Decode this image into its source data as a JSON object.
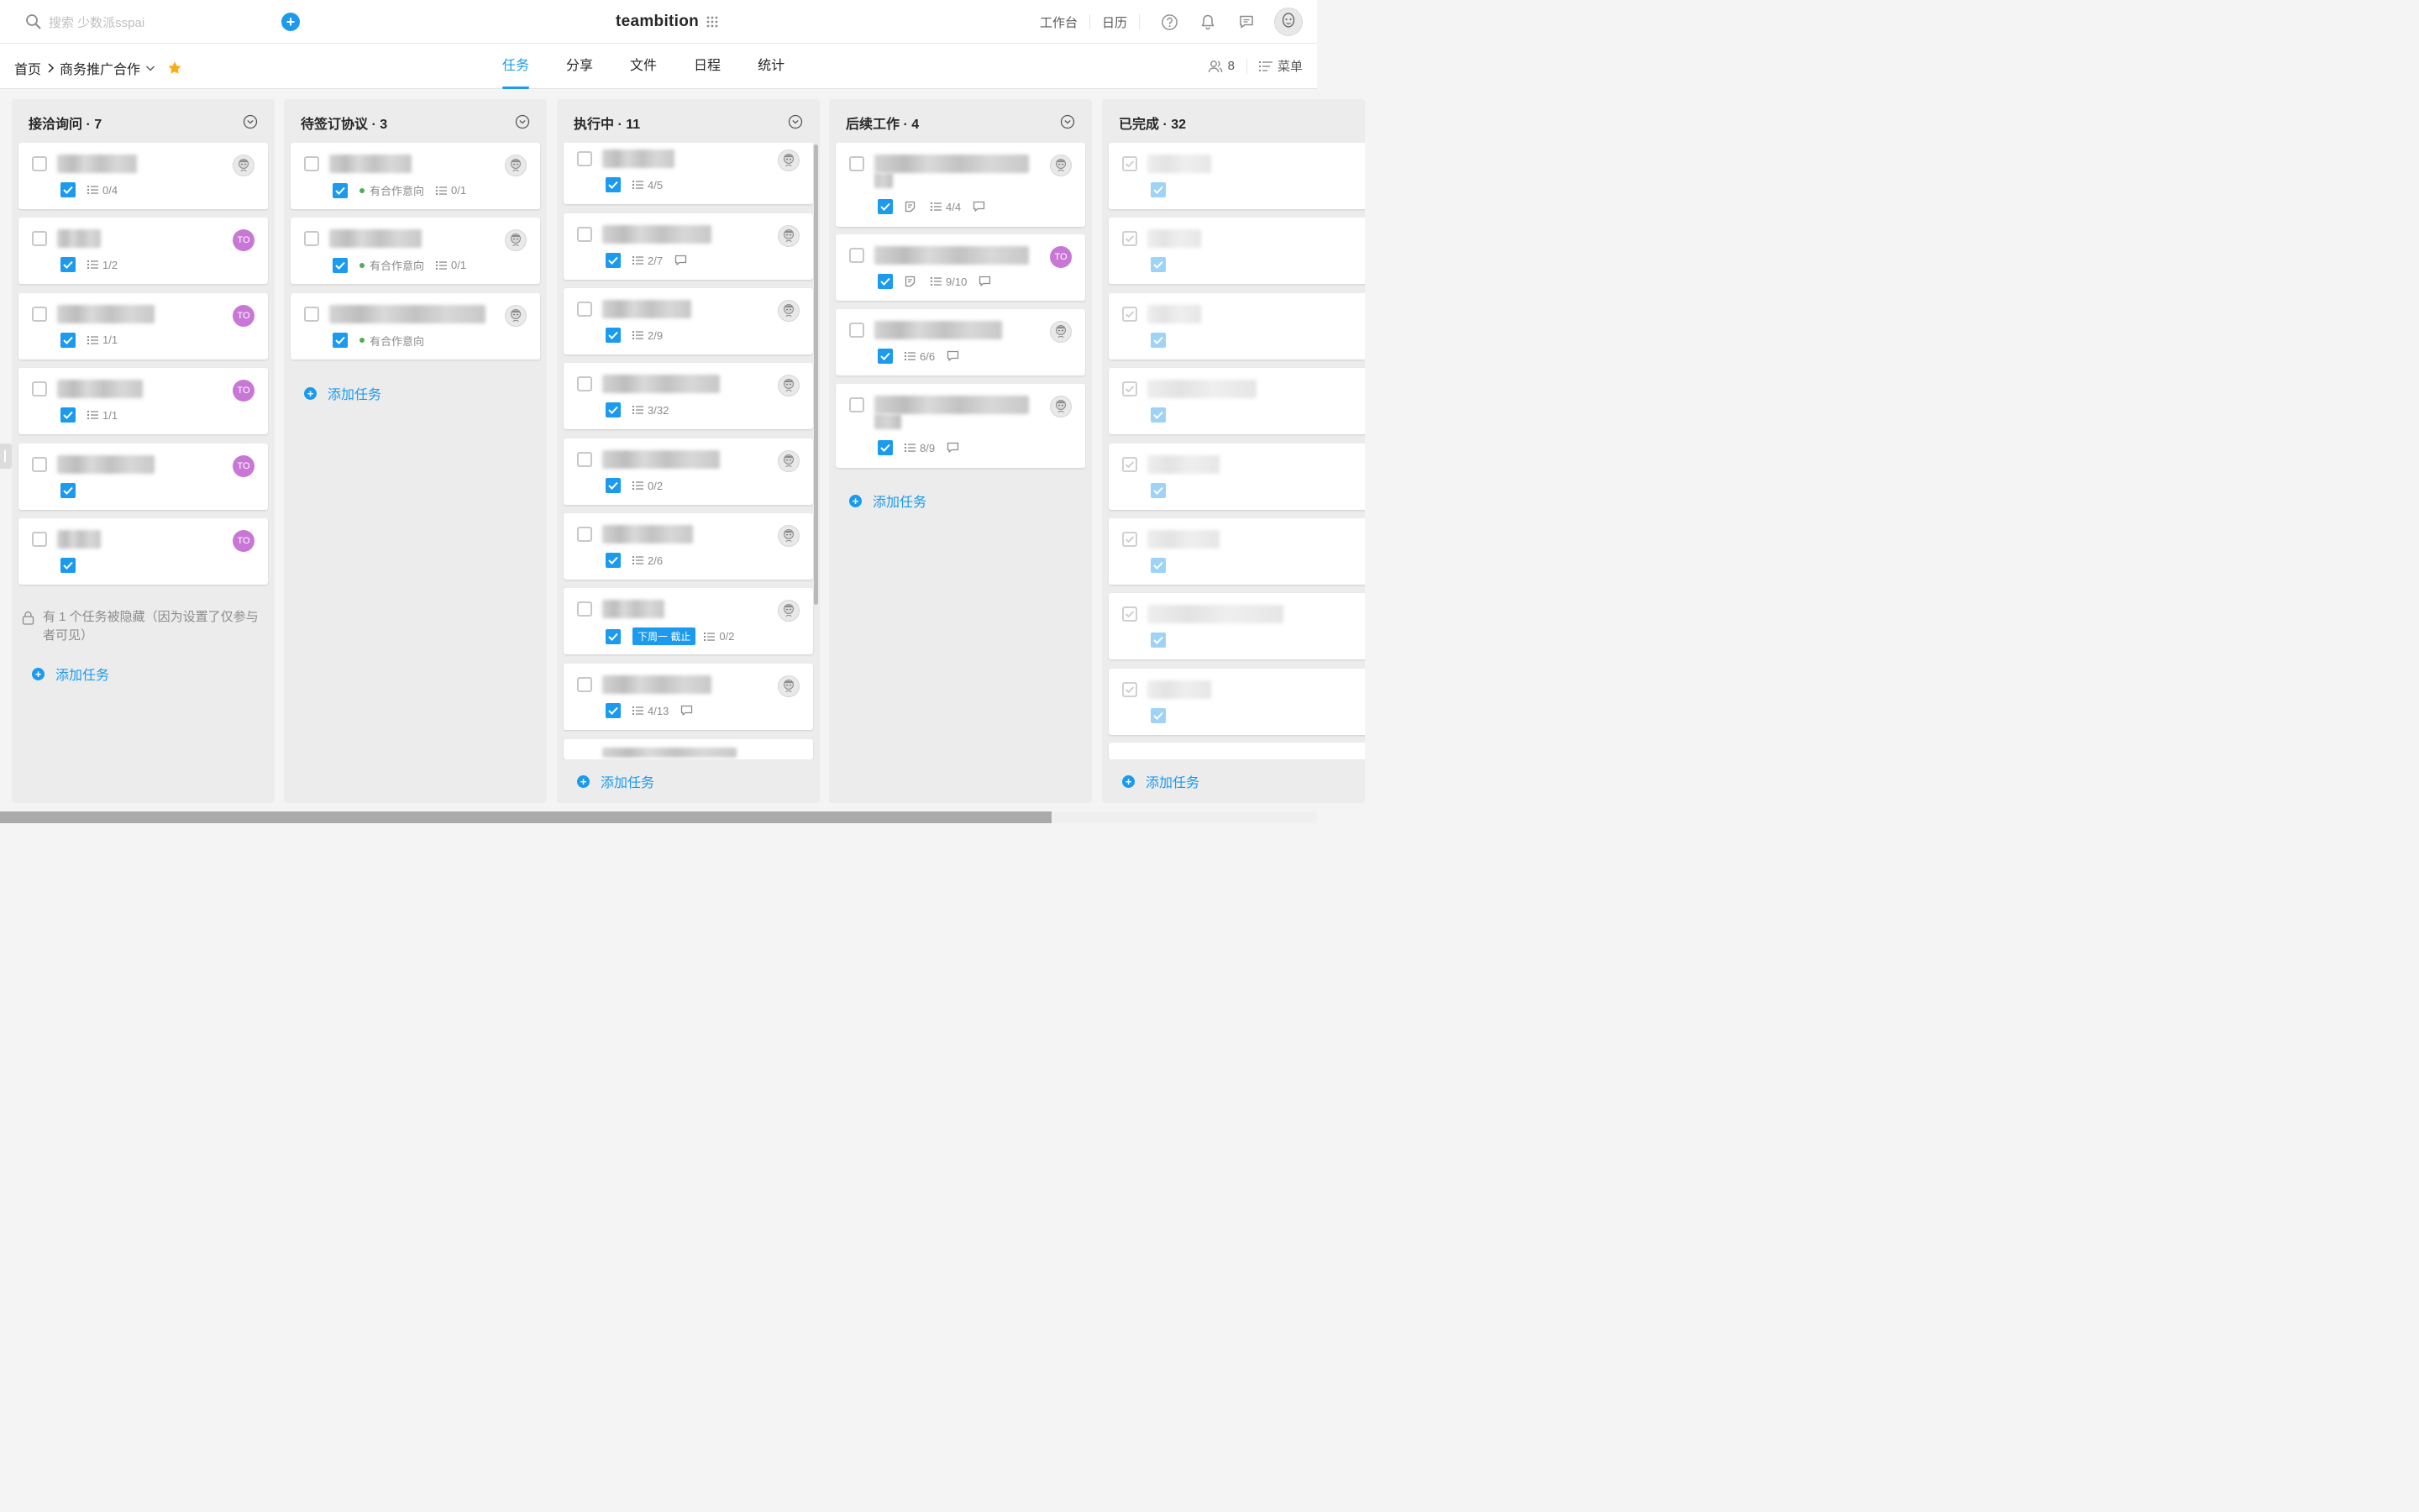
{
  "header": {
    "search_placeholder": "搜索 少数派sspai",
    "add_label": "+",
    "logo": "teambition",
    "nav": [
      "工作台",
      "日历"
    ]
  },
  "subheader": {
    "breadcrumb_home": "首页",
    "project_name": "商务推广合作",
    "tabs": [
      "任务",
      "分享",
      "文件",
      "日程",
      "统计"
    ],
    "active_tab": "任务",
    "members_count": "8",
    "menu_label": "菜单"
  },
  "colors": {
    "accent": "#1b9aee",
    "avatar_to": "#c977d6",
    "dot_green": "#4caf50"
  },
  "columns": [
    {
      "title": "接洽询问 · 7",
      "add_label": "添加任务",
      "hidden_note": "有 1 个任务被隐藏（因为设置了仅参与者可见）",
      "cards": [
        {
          "subtasks": "0/4",
          "avatar": "face"
        },
        {
          "subtasks": "1/2",
          "avatar": "TO"
        },
        {
          "subtasks": "1/1",
          "avatar": "TO"
        },
        {
          "subtasks": "1/1",
          "avatar": "TO"
        },
        {
          "subtasks": "",
          "avatar": "TO"
        },
        {
          "subtasks": "",
          "avatar": "TO"
        }
      ]
    },
    {
      "title": "待签订协议 · 3",
      "add_label": "添加任务",
      "cards": [
        {
          "tag": "有合作意向",
          "subtasks": "0/1",
          "avatar": "face"
        },
        {
          "tag": "有合作意向",
          "subtasks": "0/1",
          "avatar": "face"
        },
        {
          "tag": "有合作意向",
          "subtasks": "",
          "avatar": "face"
        }
      ]
    },
    {
      "title": "执行中 · 11",
      "add_label": "添加任务",
      "due_badge": "下周一 截止",
      "cards": [
        {
          "subtasks": "4/5",
          "comment": false
        },
        {
          "subtasks": "2/7",
          "comment": true
        },
        {
          "subtasks": "2/9",
          "comment": false
        },
        {
          "subtasks": "3/32",
          "comment": false
        },
        {
          "subtasks": "0/2",
          "comment": false
        },
        {
          "subtasks": "2/6",
          "comment": false
        },
        {
          "subtasks": "0/2",
          "comment": false
        },
        {
          "subtasks": "4/13",
          "comment": true
        }
      ]
    },
    {
      "title": "后续工作 · 4",
      "add_label": "添加任务",
      "cards": [
        {
          "subtasks": "4/4",
          "avatar": "face"
        },
        {
          "subtasks": "9/10",
          "avatar": "TO"
        },
        {
          "subtasks": "6/6",
          "avatar": "face"
        },
        {
          "subtasks": "8/9",
          "avatar": "face"
        }
      ]
    },
    {
      "title": "已完成 · 32",
      "add_label": "添加任务",
      "cards": 8
    }
  ],
  "avatar_to_label": "TO"
}
